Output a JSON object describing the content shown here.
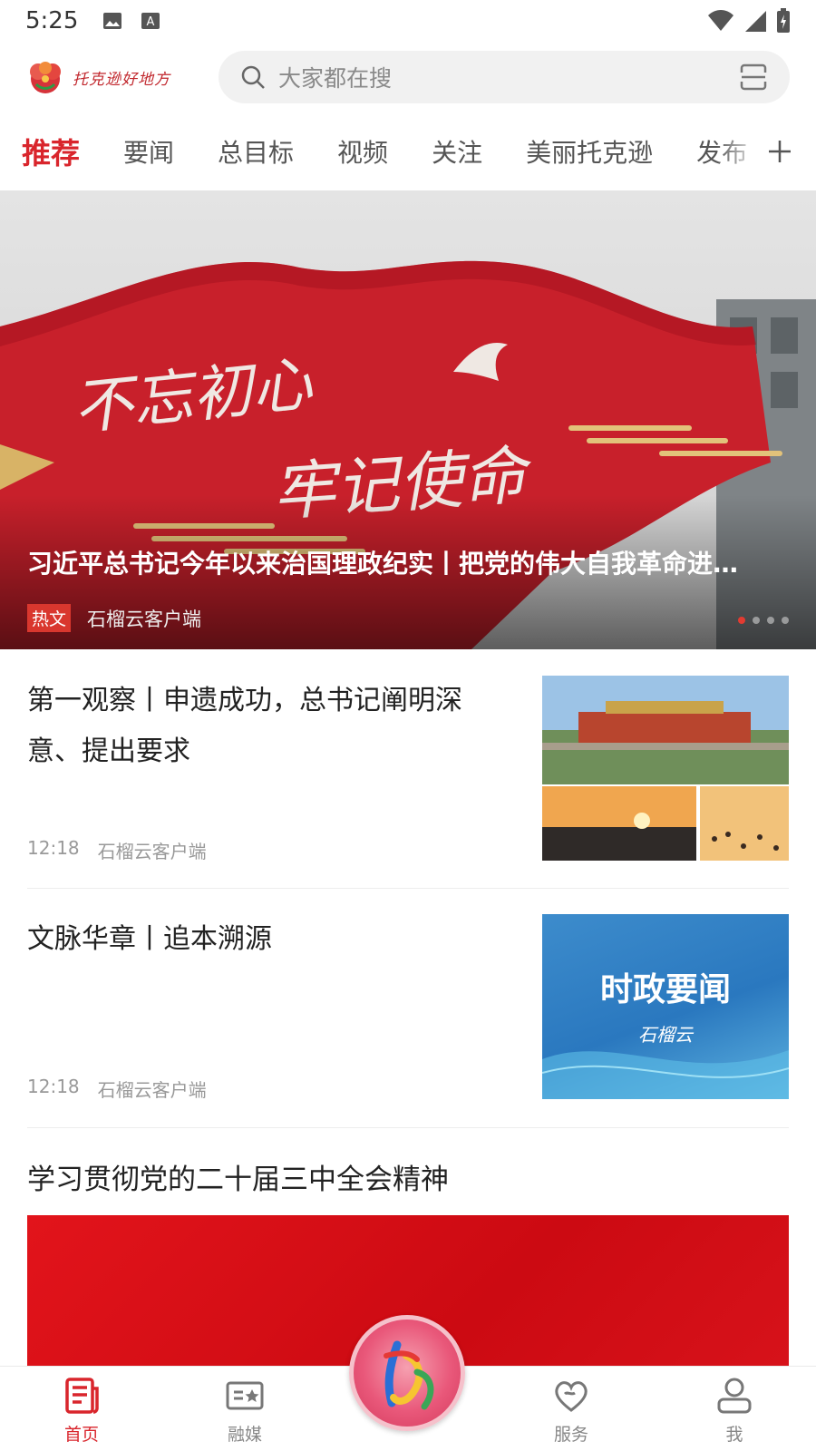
{
  "status_bar": {
    "time": "5:25"
  },
  "header": {
    "brand_text": "托克逊好地方",
    "search_placeholder": "大家都在搜"
  },
  "tabs": [
    {
      "label": "推荐",
      "active": true
    },
    {
      "label": "要闻"
    },
    {
      "label": "总目标"
    },
    {
      "label": "视频"
    },
    {
      "label": "关注"
    },
    {
      "label": "美丽托克逊"
    },
    {
      "label": "发布"
    }
  ],
  "hero": {
    "title": "习近平总书记今年以来治国理政纪实丨把党的伟大自我革命进…",
    "badge": "热文",
    "source": "石榴云客户端",
    "image_text_line1": "不忘初心",
    "image_text_line2": "牢记使命"
  },
  "news": [
    {
      "headline": "第一观察丨申遗成功，总书记阐明深意、提出要求",
      "time": "12:18",
      "source": "石榴云客户端"
    },
    {
      "headline": "文脉华章丨追本溯源",
      "time": "12:18",
      "source": "石榴云客户端",
      "thumb_title": "时政要闻",
      "thumb_sub": "石榴云"
    }
  ],
  "section": {
    "title": "学习贯彻党的二十届三中全会精神"
  },
  "bottom_nav": [
    {
      "label": "首页",
      "icon": "news-icon",
      "active": true
    },
    {
      "label": "融媒",
      "icon": "media-icon"
    },
    {
      "label": "服务",
      "icon": "heart-icon"
    },
    {
      "label": "我",
      "icon": "user-icon"
    }
  ],
  "colors": {
    "accent": "#d9252c"
  }
}
